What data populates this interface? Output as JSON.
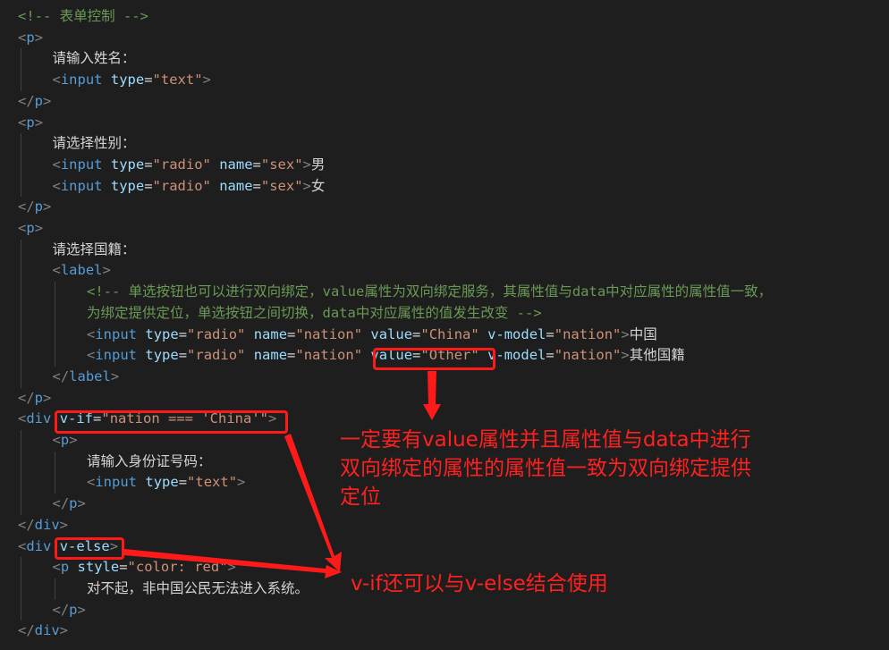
{
  "code": {
    "lines": [
      [
        [
          "c-comment",
          "<!-- 表单控制 -->"
        ]
      ],
      [
        [
          "c-punct",
          "<"
        ],
        [
          "c-tag",
          "p"
        ],
        [
          "c-punct",
          ">"
        ]
      ],
      [
        [
          "c-text",
          "请输入姓名："
        ]
      ],
      [
        [
          "c-punct",
          "<"
        ],
        [
          "c-tag",
          "input"
        ],
        [
          "c-text",
          " "
        ],
        [
          "c-attr",
          "type"
        ],
        [
          "c-eq",
          "="
        ],
        [
          "c-str",
          "\"text\""
        ],
        [
          "c-punct",
          ">"
        ]
      ],
      [
        [
          "c-punct",
          "</"
        ],
        [
          "c-tag",
          "p"
        ],
        [
          "c-punct",
          ">"
        ]
      ],
      [
        [
          "c-punct",
          "<"
        ],
        [
          "c-tag",
          "p"
        ],
        [
          "c-punct",
          ">"
        ]
      ],
      [
        [
          "c-text",
          "请选择性别："
        ]
      ],
      [
        [
          "c-punct",
          "<"
        ],
        [
          "c-tag",
          "input"
        ],
        [
          "c-text",
          " "
        ],
        [
          "c-attr",
          "type"
        ],
        [
          "c-eq",
          "="
        ],
        [
          "c-str",
          "\"radio\""
        ],
        [
          "c-text",
          " "
        ],
        [
          "c-attr",
          "name"
        ],
        [
          "c-eq",
          "="
        ],
        [
          "c-str",
          "\"sex\""
        ],
        [
          "c-punct",
          ">"
        ],
        [
          "c-text",
          "男"
        ]
      ],
      [
        [
          "c-punct",
          "<"
        ],
        [
          "c-tag",
          "input"
        ],
        [
          "c-text",
          " "
        ],
        [
          "c-attr",
          "type"
        ],
        [
          "c-eq",
          "="
        ],
        [
          "c-str",
          "\"radio\""
        ],
        [
          "c-text",
          " "
        ],
        [
          "c-attr",
          "name"
        ],
        [
          "c-eq",
          "="
        ],
        [
          "c-str",
          "\"sex\""
        ],
        [
          "c-punct",
          ">"
        ],
        [
          "c-text",
          "女"
        ]
      ],
      [
        [
          "c-punct",
          "</"
        ],
        [
          "c-tag",
          "p"
        ],
        [
          "c-punct",
          ">"
        ]
      ],
      [
        [
          "c-punct",
          "<"
        ],
        [
          "c-tag",
          "p"
        ],
        [
          "c-punct",
          ">"
        ]
      ],
      [
        [
          "c-text",
          "请选择国籍："
        ]
      ],
      [
        [
          "c-punct",
          "<"
        ],
        [
          "c-tag",
          "label"
        ],
        [
          "c-punct",
          ">"
        ]
      ],
      [
        [
          "c-comment",
          "<!-- 单选按钮也可以进行双向绑定，value属性为双向绑定服务，其属性值与data中对应属性的属性值一致，"
        ]
      ],
      [
        [
          "c-comment",
          "为绑定提供定位，单选按钮之间切换，data中对应属性的值发生改变 -->"
        ]
      ],
      [
        [
          "c-punct",
          "<"
        ],
        [
          "c-tag",
          "input"
        ],
        [
          "c-text",
          " "
        ],
        [
          "c-attr",
          "type"
        ],
        [
          "c-eq",
          "="
        ],
        [
          "c-str",
          "\"radio\""
        ],
        [
          "c-text",
          " "
        ],
        [
          "c-attr",
          "name"
        ],
        [
          "c-eq",
          "="
        ],
        [
          "c-str",
          "\"nation\""
        ],
        [
          "c-text",
          " "
        ],
        [
          "c-attr",
          "value"
        ],
        [
          "c-eq",
          "="
        ],
        [
          "c-str",
          "\"China\""
        ],
        [
          "c-text",
          " "
        ],
        [
          "c-attr",
          "v-model"
        ],
        [
          "c-eq",
          "="
        ],
        [
          "c-str",
          "\"nation\""
        ],
        [
          "c-punct",
          ">"
        ],
        [
          "c-text",
          "中国"
        ]
      ],
      [
        [
          "c-punct",
          "<"
        ],
        [
          "c-tag",
          "input"
        ],
        [
          "c-text",
          " "
        ],
        [
          "c-attr",
          "type"
        ],
        [
          "c-eq",
          "="
        ],
        [
          "c-str",
          "\"radio\""
        ],
        [
          "c-text",
          " "
        ],
        [
          "c-attr",
          "name"
        ],
        [
          "c-eq",
          "="
        ],
        [
          "c-str",
          "\"nation\""
        ],
        [
          "c-text",
          " "
        ],
        [
          "c-attr",
          "value"
        ],
        [
          "c-eq",
          "="
        ],
        [
          "c-str",
          "\"Other\""
        ],
        [
          "c-text",
          " "
        ],
        [
          "c-attr",
          "v-model"
        ],
        [
          "c-eq",
          "="
        ],
        [
          "c-str",
          "\"nation\""
        ],
        [
          "c-punct",
          ">"
        ],
        [
          "c-text",
          "其他国籍"
        ]
      ],
      [
        [
          "c-punct",
          "</"
        ],
        [
          "c-tag",
          "label"
        ],
        [
          "c-punct",
          ">"
        ]
      ],
      [
        [
          "c-punct",
          "</"
        ],
        [
          "c-tag",
          "p"
        ],
        [
          "c-punct",
          ">"
        ]
      ],
      [
        [
          "c-punct",
          "<"
        ],
        [
          "c-tag",
          "div"
        ],
        [
          "c-text",
          " "
        ],
        [
          "c-attr",
          "v-if"
        ],
        [
          "c-eq",
          "="
        ],
        [
          "c-str",
          "\"nation === 'China'\""
        ],
        [
          "c-punct",
          ">"
        ]
      ],
      [
        [
          "c-punct",
          "<"
        ],
        [
          "c-tag",
          "p"
        ],
        [
          "c-punct",
          ">"
        ]
      ],
      [
        [
          "c-text",
          "请输入身份证号码："
        ]
      ],
      [
        [
          "c-punct",
          "<"
        ],
        [
          "c-tag",
          "input"
        ],
        [
          "c-text",
          " "
        ],
        [
          "c-attr",
          "type"
        ],
        [
          "c-eq",
          "="
        ],
        [
          "c-str",
          "\"text\""
        ],
        [
          "c-punct",
          ">"
        ]
      ],
      [
        [
          "c-punct",
          "</"
        ],
        [
          "c-tag",
          "p"
        ],
        [
          "c-punct",
          ">"
        ]
      ],
      [
        [
          "c-punct",
          "</"
        ],
        [
          "c-tag",
          "div"
        ],
        [
          "c-punct",
          ">"
        ]
      ],
      [
        [
          "c-punct",
          "<"
        ],
        [
          "c-tag",
          "div"
        ],
        [
          "c-text",
          " "
        ],
        [
          "c-attr",
          "v-else"
        ],
        [
          "c-punct",
          ">"
        ]
      ],
      [
        [
          "c-punct",
          "<"
        ],
        [
          "c-tag",
          "p"
        ],
        [
          "c-text",
          " "
        ],
        [
          "c-attr",
          "style"
        ],
        [
          "c-eq",
          "="
        ],
        [
          "c-str",
          "\"color: red\""
        ],
        [
          "c-punct",
          ">"
        ]
      ],
      [
        [
          "c-text",
          "对不起，非中国公民无法进入系统。"
        ]
      ],
      [
        [
          "c-punct",
          "</"
        ],
        [
          "c-tag",
          "p"
        ],
        [
          "c-punct",
          ">"
        ]
      ],
      [
        [
          "c-punct",
          "</"
        ],
        [
          "c-tag",
          "div"
        ],
        [
          "c-punct",
          ">"
        ]
      ]
    ]
  },
  "annotations": {
    "note_value": [
      "一定要有value属性并且属性值与data中进行",
      "双向绑定的属性的属性值一致为双向绑定提供",
      "定位"
    ],
    "note_vif": "v-if还可以与v-else结合使用"
  },
  "colors": {
    "background": "#1e1e1e",
    "comment": "#6a9955",
    "tag": "#569cd6",
    "attribute": "#9cdcfe",
    "string": "#ce9178",
    "text": "#d4d4d4",
    "annotation": "#ff1a1a"
  }
}
